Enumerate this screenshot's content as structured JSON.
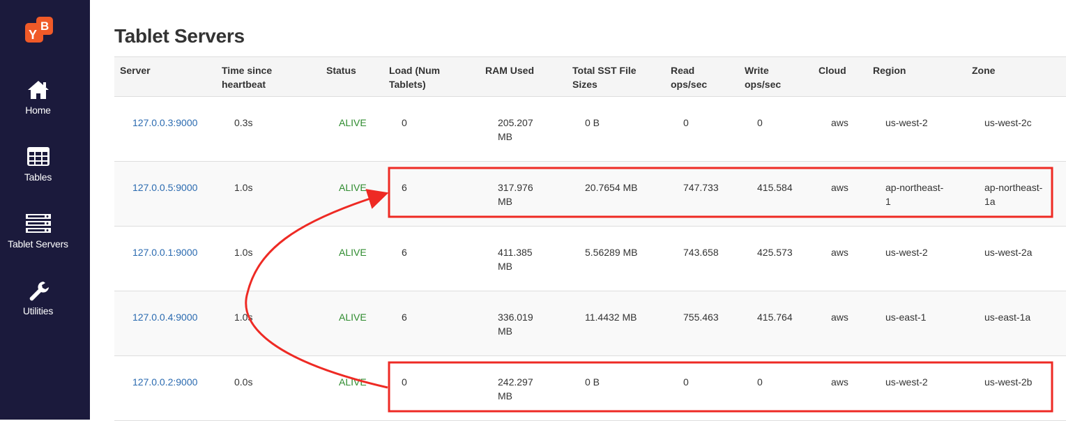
{
  "page": {
    "title": "Tablet Servers"
  },
  "sidebar": {
    "items": [
      {
        "label": "Home",
        "icon": "home-icon"
      },
      {
        "label": "Tables",
        "icon": "table-icon"
      },
      {
        "label": "Tablet Servers",
        "icon": "server-icon"
      },
      {
        "label": "Utilities",
        "icon": "wrench-icon"
      }
    ]
  },
  "logo": {
    "text_left": "Y",
    "text_right": "B"
  },
  "table": {
    "headers": {
      "server": "Server",
      "heartbeat_1": "Time since",
      "heartbeat_2": "heartbeat",
      "status": "Status",
      "load_1": "Load (Num",
      "load_2": "Tablets)",
      "ram": "RAM Used",
      "sst_1": "Total SST File",
      "sst_2": "Sizes",
      "read_1": "Read",
      "read_2": "ops/sec",
      "write_1": "Write",
      "write_2": "ops/sec",
      "cloud": "Cloud",
      "region": "Region",
      "zone": "Zone"
    },
    "rows": [
      {
        "server": "127.0.0.3:9000",
        "heartbeat": "0.3s",
        "status": "ALIVE",
        "load": "0",
        "ram_1": "205.207",
        "ram_2": "MB",
        "sst": "0 B",
        "read": "0",
        "write": "0",
        "cloud": "aws",
        "region_1": "us-west-2",
        "region_2": "",
        "zone_1": "us-west-2c",
        "zone_2": ""
      },
      {
        "server": "127.0.0.5:9000",
        "heartbeat": "1.0s",
        "status": "ALIVE",
        "load": "6",
        "ram_1": "317.976",
        "ram_2": "MB",
        "sst": "20.7654 MB",
        "read": "747.733",
        "write": "415.584",
        "cloud": "aws",
        "region_1": "ap-northeast-",
        "region_2": "1",
        "zone_1": "ap-northeast-",
        "zone_2": "1a"
      },
      {
        "server": "127.0.0.1:9000",
        "heartbeat": "1.0s",
        "status": "ALIVE",
        "load": "6",
        "ram_1": "411.385",
        "ram_2": "MB",
        "sst": "5.56289 MB",
        "read": "743.658",
        "write": "425.573",
        "cloud": "aws",
        "region_1": "us-west-2",
        "region_2": "",
        "zone_1": "us-west-2a",
        "zone_2": ""
      },
      {
        "server": "127.0.0.4:9000",
        "heartbeat": "1.0s",
        "status": "ALIVE",
        "load": "6",
        "ram_1": "336.019",
        "ram_2": "MB",
        "sst": "11.4432 MB",
        "read": "755.463",
        "write": "415.764",
        "cloud": "aws",
        "region_1": "us-east-1",
        "region_2": "",
        "zone_1": "us-east-1a",
        "zone_2": ""
      },
      {
        "server": "127.0.0.2:9000",
        "heartbeat": "0.0s",
        "status": "ALIVE",
        "load": "0",
        "ram_1": "242.297",
        "ram_2": "MB",
        "sst": "0 B",
        "read": "0",
        "write": "0",
        "cloud": "aws",
        "region_1": "us-west-2",
        "region_2": "",
        "zone_1": "us-west-2b",
        "zone_2": ""
      }
    ]
  },
  "colors": {
    "sidebar_bg": "#1b1a3c",
    "logo_orange": "#f05a28",
    "link": "#2a6ab0",
    "alive": "#2e8b2e",
    "annotation_red": "#ee2a24"
  }
}
